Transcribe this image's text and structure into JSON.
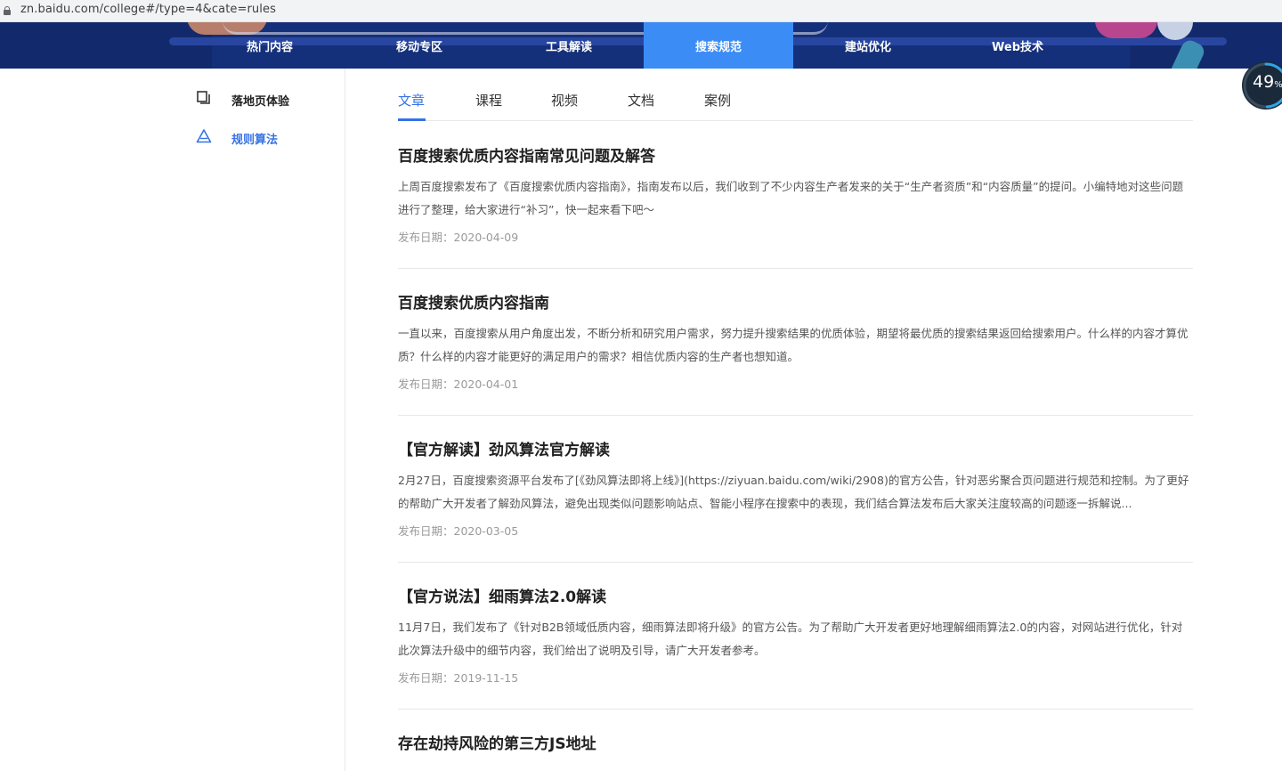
{
  "browser": {
    "url": "zn.baidu.com/college#/type=4&cate=rules"
  },
  "nav": {
    "items": [
      {
        "label": "热门内容"
      },
      {
        "label": "移动专区"
      },
      {
        "label": "工具解读"
      },
      {
        "label": "搜索规范"
      },
      {
        "label": "建站优化"
      },
      {
        "label": "Web技术"
      }
    ],
    "active_index": 3
  },
  "progress": {
    "value": "49",
    "unit": "%"
  },
  "sidebar": {
    "items": [
      {
        "label": "落地页体验",
        "icon": "copy-icon"
      },
      {
        "label": "规则算法",
        "icon": "warning-triangle-icon"
      }
    ],
    "active_index": 1
  },
  "tabs": [
    {
      "label": "文章"
    },
    {
      "label": "课程"
    },
    {
      "label": "视频"
    },
    {
      "label": "文档"
    },
    {
      "label": "案例"
    }
  ],
  "articles": [
    {
      "title": "百度搜索优质内容指南常见问题及解答",
      "desc": "上周百度搜索发布了《百度搜索优质内容指南》，指南发布以后，我们收到了不少内容生产者发来的关于“生产者资质”和“内容质量”的提问。小编特地对这些问题进行了整理，给大家进行“补习”，快一起来看下吧～",
      "date": "发布日期：2020-04-09"
    },
    {
      "title": "百度搜索优质内容指南",
      "desc": "一直以来，百度搜索从用户角度出发，不断分析和研究用户需求，努力提升搜索结果的优质体验，期望将最优质的搜索结果返回给搜索用户。什么样的内容才算优质？什么样的内容才能更好的满足用户的需求？相信优质内容的生产者也想知道。",
      "date": "发布日期：2020-04-01"
    },
    {
      "title": "【官方解读】劲风算法官方解读",
      "desc": "2月27日，百度搜索资源平台发布了[《劲风算法即将上线》](https://ziyuan.baidu.com/wiki/2908)的官方公告，针对恶劣聚合页问题进行规范和控制。为了更好的帮助广大开发者了解劲风算法，避免出现类似问题影响站点、智能小程序在搜索中的表现，我们结合算法发布后大家关注度较高的问题逐一拆解说...",
      "date": "发布日期：2020-03-05"
    },
    {
      "title": "【官方说法】细雨算法2.0解读",
      "desc": "11月7日，我们发布了《针对B2B领域低质内容，细雨算法即将升级》的官方公告。为了帮助广大开发者更好地理解细雨算法2.0的内容，对网站进行优化，针对此次算法升级中的细节内容，我们给出了说明及引导，请广大开发者参考。",
      "date": "发布日期：2019-11-15"
    },
    {
      "title": "存在劫持风险的第三方JS地址",
      "desc": "",
      "date": ""
    }
  ]
}
